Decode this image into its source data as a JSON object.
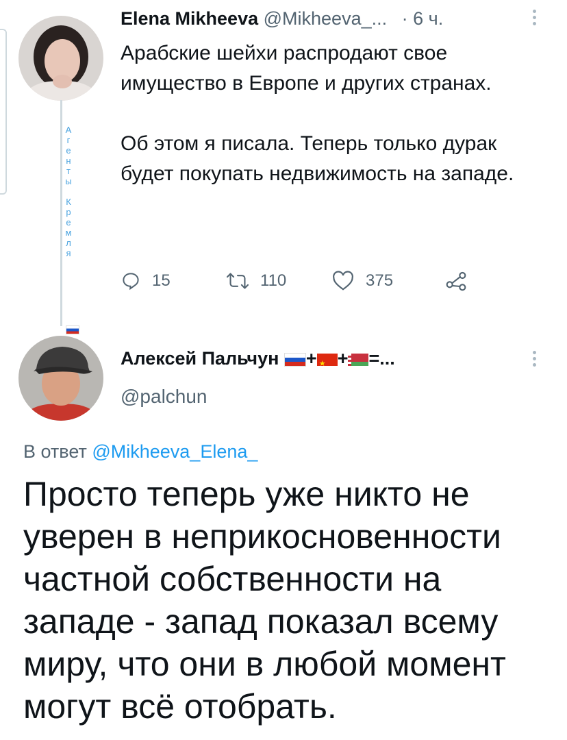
{
  "side_note": {
    "text1": [
      "А",
      "г",
      "е",
      "н",
      "т",
      "ы"
    ],
    "text2": [
      "К",
      "р",
      "е",
      "м",
      "л",
      "я"
    ]
  },
  "tweet1": {
    "author_name": "Elena Mikheeva",
    "author_handle": "@Mikheeva_...",
    "time": "· 6 ч.",
    "text_p1": "Арабские шейхи распродают свое имущество в Европе и других странах.",
    "text_p2": "Об этом я писала. Теперь только дурак будет покупать недвижимость на западе.",
    "replies": "15",
    "retweets": "110",
    "likes": "375"
  },
  "tweet2": {
    "author_name": "Алексей Пальчун",
    "name_suffix": "=...",
    "author_handle": "@palchun",
    "replying_prefix": "В ответ",
    "replying_to": "@Mikheeva_Elena_",
    "text": "Просто теперь уже никто не уверен в неприкосновенности частной собственности на западе - запад показал всему миру, что они в любой момент могут всё отобрать."
  },
  "icons": [
    "reply-icon",
    "retweet-icon",
    "like-icon",
    "share-icon",
    "more-icon"
  ]
}
